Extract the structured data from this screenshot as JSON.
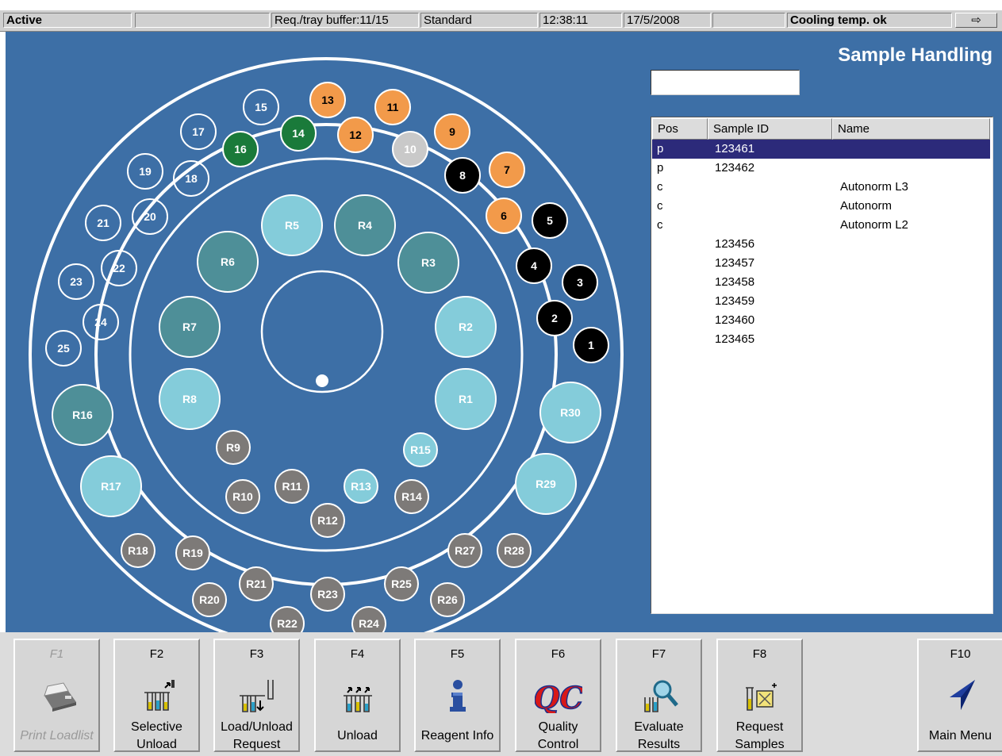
{
  "status_bar": {
    "state": "Active",
    "buffer": "Req./tray buffer:11/15",
    "mode": "Standard",
    "time": "12:38:11",
    "date": "17/5/2008",
    "cooling": "Cooling temp. ok",
    "arrow_icon": "back-arrow-icon"
  },
  "page_title": "Sample Handling",
  "search": {
    "value": ""
  },
  "rotor": {
    "colors": {
      "empty": "#3d6fa6",
      "orange": "#f29a4a",
      "green": "#1a7a3a",
      "grey": "#c9c9c9",
      "black": "#000000",
      "reagent_light": "#84ccda",
      "reagent_dark": "#4e8f98",
      "reagent_grey": "#7d7a78"
    },
    "sample_positions": [
      {
        "label": "1",
        "status": "black"
      },
      {
        "label": "2",
        "status": "black"
      },
      {
        "label": "3",
        "status": "black"
      },
      {
        "label": "4",
        "status": "black"
      },
      {
        "label": "5",
        "status": "black"
      },
      {
        "label": "6",
        "status": "orange"
      },
      {
        "label": "7",
        "status": "orange"
      },
      {
        "label": "8",
        "status": "black"
      },
      {
        "label": "9",
        "status": "orange"
      },
      {
        "label": "10",
        "status": "grey"
      },
      {
        "label": "11",
        "status": "orange"
      },
      {
        "label": "12",
        "status": "orange"
      },
      {
        "label": "13",
        "status": "orange"
      },
      {
        "label": "14",
        "status": "green"
      },
      {
        "label": "15",
        "status": "empty"
      },
      {
        "label": "16",
        "status": "green"
      },
      {
        "label": "17",
        "status": "empty"
      },
      {
        "label": "18",
        "status": "empty"
      },
      {
        "label": "19",
        "status": "empty"
      },
      {
        "label": "20",
        "status": "empty"
      },
      {
        "label": "21",
        "status": "empty"
      },
      {
        "label": "22",
        "status": "empty"
      },
      {
        "label": "23",
        "status": "empty"
      },
      {
        "label": "24",
        "status": "empty"
      },
      {
        "label": "25",
        "status": "empty"
      }
    ],
    "reagent_positions": [
      {
        "label": "R1",
        "status": "reagent_light"
      },
      {
        "label": "R2",
        "status": "reagent_light"
      },
      {
        "label": "R3",
        "status": "reagent_dark"
      },
      {
        "label": "R4",
        "status": "reagent_dark"
      },
      {
        "label": "R5",
        "status": "reagent_light"
      },
      {
        "label": "R6",
        "status": "reagent_dark"
      },
      {
        "label": "R7",
        "status": "reagent_dark"
      },
      {
        "label": "R8",
        "status": "reagent_light"
      },
      {
        "label": "R9",
        "status": "reagent_grey"
      },
      {
        "label": "R10",
        "status": "reagent_grey"
      },
      {
        "label": "R11",
        "status": "reagent_grey"
      },
      {
        "label": "R12",
        "status": "reagent_grey"
      },
      {
        "label": "R13",
        "status": "reagent_light"
      },
      {
        "label": "R14",
        "status": "reagent_grey"
      },
      {
        "label": "R15",
        "status": "reagent_light"
      },
      {
        "label": "R16",
        "status": "reagent_dark"
      },
      {
        "label": "R17",
        "status": "reagent_light"
      },
      {
        "label": "R18",
        "status": "reagent_grey"
      },
      {
        "label": "R19",
        "status": "reagent_grey"
      },
      {
        "label": "R20",
        "status": "reagent_grey"
      },
      {
        "label": "R21",
        "status": "reagent_grey"
      },
      {
        "label": "R22",
        "status": "reagent_grey"
      },
      {
        "label": "R23",
        "status": "reagent_grey"
      },
      {
        "label": "R24",
        "status": "reagent_grey"
      },
      {
        "label": "R25",
        "status": "reagent_grey"
      },
      {
        "label": "R26",
        "status": "reagent_grey"
      },
      {
        "label": "R27",
        "status": "reagent_grey"
      },
      {
        "label": "R28",
        "status": "reagent_grey"
      },
      {
        "label": "R29",
        "status": "reagent_light"
      },
      {
        "label": "R30",
        "status": "reagent_light"
      }
    ]
  },
  "sample_list": {
    "columns": [
      "Pos",
      "Sample ID",
      "Name"
    ],
    "rows": [
      {
        "pos": "p",
        "sample_id": "123461",
        "name": ""
      },
      {
        "pos": "p",
        "sample_id": "123462",
        "name": ""
      },
      {
        "pos": "c",
        "sample_id": "",
        "name": "Autonorm L3"
      },
      {
        "pos": "c",
        "sample_id": "",
        "name": "Autonorm"
      },
      {
        "pos": "c",
        "sample_id": "",
        "name": "Autonorm L2"
      },
      {
        "pos": "",
        "sample_id": "123456",
        "name": ""
      },
      {
        "pos": "",
        "sample_id": "123457",
        "name": ""
      },
      {
        "pos": "",
        "sample_id": "123458",
        "name": ""
      },
      {
        "pos": "",
        "sample_id": "123459",
        "name": ""
      },
      {
        "pos": "",
        "sample_id": "123460",
        "name": ""
      },
      {
        "pos": "",
        "sample_id": "123465",
        "name": ""
      }
    ],
    "selected_index": 0
  },
  "function_keys": [
    {
      "key": "F1",
      "label": [
        "Print Loadlist"
      ],
      "icon": "printer-icon",
      "enabled": false
    },
    {
      "key": "F2",
      "label": [
        "Selective",
        "Unload"
      ],
      "icon": "selective-unload-icon",
      "enabled": true
    },
    {
      "key": "F3",
      "label": [
        "Load/Unload",
        "Request"
      ],
      "icon": "load-unload-icon",
      "enabled": true
    },
    {
      "key": "F4",
      "label": [
        "Unload"
      ],
      "icon": "unload-icon",
      "enabled": true
    },
    {
      "key": "F5",
      "label": [
        "Reagent Info"
      ],
      "icon": "info-icon",
      "enabled": true
    },
    {
      "key": "F6",
      "label": [
        "Quality",
        "Control"
      ],
      "icon": "qc-icon",
      "enabled": true
    },
    {
      "key": "F7",
      "label": [
        "Evaluate",
        "Results"
      ],
      "icon": "evaluate-icon",
      "enabled": true
    },
    {
      "key": "F8",
      "label": [
        "Request",
        "Samples"
      ],
      "icon": "request-samples-icon",
      "enabled": true
    },
    {
      "key": "F10",
      "label": [
        "Main Menu"
      ],
      "icon": "navigation-arrow-icon",
      "enabled": true
    }
  ]
}
